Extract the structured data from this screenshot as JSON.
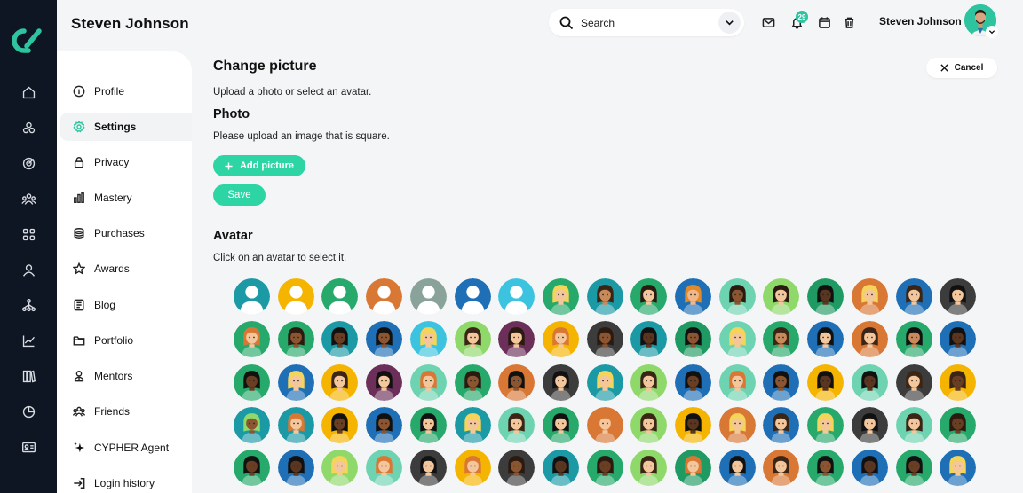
{
  "header": {
    "title": "Steven Johnson",
    "search_placeholder": "Search",
    "notification_count": "29",
    "user_name": "Steven Johnson"
  },
  "rail": {
    "icons": [
      "home-icon",
      "apps-icon",
      "target-icon",
      "community-icon",
      "grid-icon",
      "user-icon",
      "network-icon",
      "chart-icon",
      "library-icon",
      "pie-chart-icon",
      "id-card-icon"
    ]
  },
  "sidebar": {
    "items": [
      {
        "label": "Profile",
        "icon": "info-icon"
      },
      {
        "label": "Settings",
        "icon": "gear-icon",
        "active": true
      },
      {
        "label": "Privacy",
        "icon": "lock-icon"
      },
      {
        "label": "Mastery",
        "icon": "bar-chart-icon"
      },
      {
        "label": "Purchases",
        "icon": "coins-icon"
      },
      {
        "label": "Awards",
        "icon": "star-icon"
      },
      {
        "label": "Blog",
        "icon": "document-icon"
      },
      {
        "label": "Portfolio",
        "icon": "folder-icon"
      },
      {
        "label": "Mentors",
        "icon": "mentor-icon"
      },
      {
        "label": "Friends",
        "icon": "friends-icon"
      },
      {
        "label": "CYPHER Agent",
        "icon": "sparkle-icon"
      },
      {
        "label": "Login history",
        "icon": "login-icon"
      }
    ]
  },
  "main": {
    "title": "Change picture",
    "cancel_label": "Cancel",
    "intro": "Upload a photo or select an avatar.",
    "photo_heading": "Photo",
    "photo_hint": "Please upload an image that is square.",
    "add_picture_label": "Add picture",
    "save_label": "Save",
    "avatar_heading": "Avatar",
    "avatar_hint": "Click on an avatar to select it."
  },
  "avatars": {
    "rows": [
      [
        {
          "bg": "#1b9aa6",
          "skin": "#fff",
          "hair": "none"
        },
        {
          "bg": "#f5b400",
          "skin": "#fff",
          "hair": "none"
        },
        {
          "bg": "#27a96b",
          "skin": "#fff",
          "hair": "none"
        },
        {
          "bg": "#d97735",
          "skin": "#fff",
          "hair": "none"
        },
        {
          "bg": "#8aa39a",
          "skin": "#fff",
          "hair": "none"
        },
        {
          "bg": "#1f6fb6",
          "skin": "#fff",
          "hair": "none"
        },
        {
          "bg": "#3cc3e0",
          "skin": "#fff",
          "hair": "none"
        },
        {
          "bg": "#27a96b",
          "skin": "#f4c69b",
          "hair": "#f5d45a"
        },
        {
          "bg": "#1b9aa6",
          "skin": "#c98a5a",
          "hair": "#3b2516"
        },
        {
          "bg": "#27a96b",
          "skin": "#f4c69b",
          "hair": "#2a1a10"
        },
        {
          "bg": "#1f6fb6",
          "skin": "#f0b888",
          "hair": "#e08a2a"
        },
        {
          "bg": "#6dd3b0",
          "skin": "#8a5530",
          "hair": "#2a1a10"
        },
        {
          "bg": "#8fd86a",
          "skin": "#f4c69b",
          "hair": "#2a1a10"
        },
        {
          "bg": "#1f9a62",
          "skin": "#5a3520",
          "hair": "#111"
        },
        {
          "bg": "#d97735",
          "skin": "#f4c69b",
          "hair": "#f5d45a"
        },
        {
          "bg": "#1f6fb6",
          "skin": "#f4c69b",
          "hair": "#3b2516"
        },
        {
          "bg": "#3c3c3c",
          "skin": "#f4c69b",
          "hair": "#111"
        }
      ],
      [
        {
          "bg": "#27a96b",
          "skin": "#f4c69b",
          "hair": "#d97735"
        },
        {
          "bg": "#27a96b",
          "skin": "#8a5530",
          "hair": "#2a1a10"
        },
        {
          "bg": "#1b9aa6",
          "skin": "#6a3e22",
          "hair": "#111"
        },
        {
          "bg": "#1f6fb6",
          "skin": "#8a5530",
          "hair": "#111"
        },
        {
          "bg": "#3cc3e0",
          "skin": "#f4c69b",
          "hair": "#f5d45a"
        },
        {
          "bg": "#8fd86a",
          "skin": "#f4c69b",
          "hair": "#3b2516"
        },
        {
          "bg": "#6b2f5a",
          "skin": "#f4c69b",
          "hair": "#2a1a10"
        },
        {
          "bg": "#f5b400",
          "skin": "#f4c69b",
          "hair": "#d97735"
        },
        {
          "bg": "#3c3c3c",
          "skin": "#8a5530",
          "hair": "#2a1a10"
        },
        {
          "bg": "#1b9aa6",
          "skin": "#5a3520",
          "hair": "#111"
        },
        {
          "bg": "#1f9a62",
          "skin": "#8a5530",
          "hair": "#111"
        },
        {
          "bg": "#6dd3b0",
          "skin": "#f4c69b",
          "hair": "#f5d45a"
        },
        {
          "bg": "#27a96b",
          "skin": "#c98a5a",
          "hair": "#3b2516"
        },
        {
          "bg": "#1f6fb6",
          "skin": "#f4c69b",
          "hair": "#111"
        },
        {
          "bg": "#d97735",
          "skin": "#f4c69b",
          "hair": "#3b2516"
        },
        {
          "bg": "#27a96b",
          "skin": "#c98a5a",
          "hair": "#111"
        },
        {
          "bg": "#1f6fb6",
          "skin": "#5a3520",
          "hair": "#111"
        }
      ],
      [
        {
          "bg": "#27a96b",
          "skin": "#6a3e22",
          "hair": "#111"
        },
        {
          "bg": "#1f6fb6",
          "skin": "#f4c69b",
          "hair": "#f5d45a"
        },
        {
          "bg": "#f5b400",
          "skin": "#f4c69b",
          "hair": "#3b2516"
        },
        {
          "bg": "#6b2f5a",
          "skin": "#f4c69b",
          "hair": "#111"
        },
        {
          "bg": "#6dd3b0",
          "skin": "#f4c69b",
          "hair": "#d97735"
        },
        {
          "bg": "#27a96b",
          "skin": "#8a5530",
          "hair": "#2a1a10"
        },
        {
          "bg": "#d97735",
          "skin": "#8a5530",
          "hair": "#111"
        },
        {
          "bg": "#3c3c3c",
          "skin": "#f4c69b",
          "hair": "#111"
        },
        {
          "bg": "#1b9aa6",
          "skin": "#f4c69b",
          "hair": "#f5d45a"
        },
        {
          "bg": "#8fd86a",
          "skin": "#f4c69b",
          "hair": "#3b2516"
        },
        {
          "bg": "#1f6fb6",
          "skin": "#6a3e22",
          "hair": "#111"
        },
        {
          "bg": "#6dd3b0",
          "skin": "#f4c69b",
          "hair": "#d97735"
        },
        {
          "bg": "#1f6fb6",
          "skin": "#8a5530",
          "hair": "#111"
        },
        {
          "bg": "#f5b400",
          "skin": "#5a3520",
          "hair": "#111"
        },
        {
          "bg": "#6dd3b0",
          "skin": "#5a3520",
          "hair": "#111"
        },
        {
          "bg": "#3c3c3c",
          "skin": "#f4c69b",
          "hair": "#3b2516"
        },
        {
          "bg": "#f5b400",
          "skin": "#6a3e22",
          "hair": "#3b2516"
        }
      ],
      [
        {
          "bg": "#1b9aa6",
          "skin": "#8a5530",
          "hair": "#8fd86a"
        },
        {
          "bg": "#1b9aa6",
          "skin": "#f4c69b",
          "hair": "#d97735"
        },
        {
          "bg": "#f5b400",
          "skin": "#6a3e22",
          "hair": "#111"
        },
        {
          "bg": "#1f6fb6",
          "skin": "#8a5530",
          "hair": "#111"
        },
        {
          "bg": "#27a96b",
          "skin": "#f4c69b",
          "hair": "#111"
        },
        {
          "bg": "#1b9aa6",
          "skin": "#f4c69b",
          "hair": "#f5d45a"
        },
        {
          "bg": "#6dd3b0",
          "skin": "#f4c69b",
          "hair": "#3b2516"
        },
        {
          "bg": "#27a96b",
          "skin": "#f4c69b",
          "hair": "#111"
        },
        {
          "bg": "#d97735",
          "skin": "#f4c69b",
          "hair": "#d97735"
        },
        {
          "bg": "#8fd86a",
          "skin": "#f4c69b",
          "hair": "#3b2516"
        },
        {
          "bg": "#f5b400",
          "skin": "#5a3520",
          "hair": "#111"
        },
        {
          "bg": "#d97735",
          "skin": "#f4c69b",
          "hair": "#f5d45a"
        },
        {
          "bg": "#1f6fb6",
          "skin": "#f4c69b",
          "hair": "#3b2516"
        },
        {
          "bg": "#27a96b",
          "skin": "#f4c69b",
          "hair": "#f5d45a"
        },
        {
          "bg": "#3c3c3c",
          "skin": "#f4c69b",
          "hair": "#111"
        },
        {
          "bg": "#6dd3b0",
          "skin": "#f4c69b",
          "hair": "#3b2516"
        },
        {
          "bg": "#27a96b",
          "skin": "#6a3e22",
          "hair": "#2a1a10"
        }
      ],
      [
        {
          "bg": "#27a96b",
          "skin": "#6a3e22",
          "hair": "#111"
        },
        {
          "bg": "#1f6fb6",
          "skin": "#5a3520",
          "hair": "#111"
        },
        {
          "bg": "#8fd86a",
          "skin": "#f4c69b",
          "hair": "#f5d45a"
        },
        {
          "bg": "#6dd3b0",
          "skin": "#f4c69b",
          "hair": "#d97735"
        },
        {
          "bg": "#3c3c3c",
          "skin": "#f4c69b",
          "hair": "#111"
        },
        {
          "bg": "#f5b400",
          "skin": "#f4c69b",
          "hair": "#d97735"
        },
        {
          "bg": "#3c3c3c",
          "skin": "#8a5530",
          "hair": "#2a1a10"
        },
        {
          "bg": "#1b9aa6",
          "skin": "#5a3520",
          "hair": "#111"
        },
        {
          "bg": "#27a96b",
          "skin": "#6a3e22",
          "hair": "#2a1a10"
        },
        {
          "bg": "#8fd86a",
          "skin": "#f4c69b",
          "hair": "#3b2516"
        },
        {
          "bg": "#1f9a62",
          "skin": "#f4c69b",
          "hair": "#d97735"
        },
        {
          "bg": "#1f6fb6",
          "skin": "#f4c69b",
          "hair": "#111"
        },
        {
          "bg": "#d97735",
          "skin": "#f4c69b",
          "hair": "#3b2516"
        },
        {
          "bg": "#27a96b",
          "skin": "#8a5530",
          "hair": "#111"
        },
        {
          "bg": "#1f6fb6",
          "skin": "#5a3520",
          "hair": "#111"
        },
        {
          "bg": "#27a96b",
          "skin": "#6a3e22",
          "hair": "#111"
        },
        {
          "bg": "#1f6fb6",
          "skin": "#f4c69b",
          "hair": "#f5d45a"
        }
      ]
    ]
  },
  "colors": {
    "accent": "#2dd4a4",
    "rail_bg": "#0f1623",
    "page_bg": "#f4f5f7"
  }
}
